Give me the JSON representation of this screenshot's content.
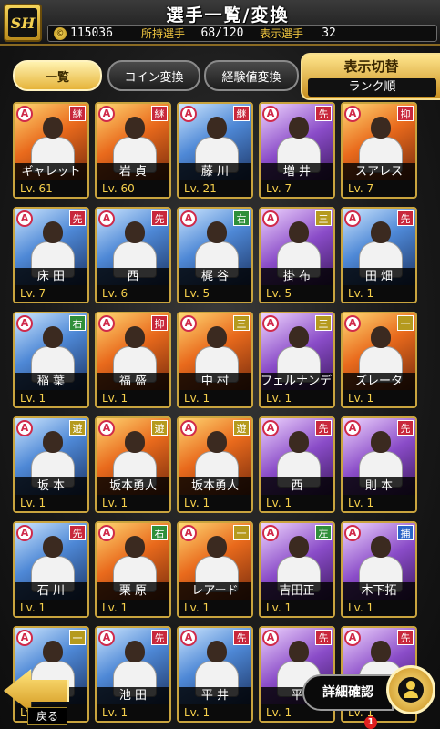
{
  "header": {
    "logo_text": "SH",
    "title": "選手一覧/変換",
    "coin_icon_glyph": "©",
    "coins": "115036",
    "owned_label": "所持選手",
    "owned_value": "68/120",
    "displayed_label": "表示選手",
    "displayed_value": "32"
  },
  "tabs": [
    {
      "label": "一覧",
      "active": true
    },
    {
      "label": "コイン変換",
      "active": false
    },
    {
      "label": "経験値変換",
      "active": false
    }
  ],
  "view_toggle": {
    "label": "表示切替",
    "sort": "ランク順"
  },
  "level_prefix": "Lv.",
  "players": [
    {
      "rank": "A",
      "pos": "継",
      "pos_color": "#c8283c",
      "name": "ギャレット",
      "level": "61",
      "bg": "orange"
    },
    {
      "rank": "A",
      "pos": "継",
      "pos_color": "#c8283c",
      "name": "岩 貞",
      "level": "60",
      "bg": "orange"
    },
    {
      "rank": "A",
      "pos": "継",
      "pos_color": "#c8283c",
      "name": "藤 川",
      "level": "21",
      "bg": "blue"
    },
    {
      "rank": "A",
      "pos": "先",
      "pos_color": "#c8283c",
      "name": "増 井",
      "level": "7",
      "bg": "purple"
    },
    {
      "rank": "A",
      "pos": "抑",
      "pos_color": "#c8283c",
      "name": "スアレス",
      "level": "7",
      "bg": "orange"
    },
    {
      "rank": "A",
      "pos": "先",
      "pos_color": "#c8283c",
      "name": "床 田",
      "level": "7",
      "bg": "blue"
    },
    {
      "rank": "A",
      "pos": "先",
      "pos_color": "#c8283c",
      "name": "西",
      "level": "6",
      "bg": "blue"
    },
    {
      "rank": "A",
      "pos": "右",
      "pos_color": "#2f8f3a",
      "name": "梶 谷",
      "level": "5",
      "bg": "blue"
    },
    {
      "rank": "A",
      "pos": "三",
      "pos_color": "#b59a1e",
      "name": "掛 布",
      "level": "5",
      "bg": "purple"
    },
    {
      "rank": "A",
      "pos": "先",
      "pos_color": "#c8283c",
      "name": "田 畑",
      "level": "1",
      "bg": "blue"
    },
    {
      "rank": "A",
      "pos": "右",
      "pos_color": "#2f8f3a",
      "name": "稲 葉",
      "level": "1",
      "bg": "blue"
    },
    {
      "rank": "A",
      "pos": "抑",
      "pos_color": "#c8283c",
      "name": "福 盛",
      "level": "1",
      "bg": "orange"
    },
    {
      "rank": "A",
      "pos": "三",
      "pos_color": "#b59a1e",
      "name": "中 村",
      "level": "1",
      "bg": "orange"
    },
    {
      "rank": "A",
      "pos": "三",
      "pos_color": "#b59a1e",
      "name": "フェルナンデス",
      "level": "1",
      "bg": "purple"
    },
    {
      "rank": "A",
      "pos": "一",
      "pos_color": "#b59a1e",
      "name": "ズレータ",
      "level": "1",
      "bg": "orange"
    },
    {
      "rank": "A",
      "pos": "遊",
      "pos_color": "#b59a1e",
      "name": "坂 本",
      "level": "1",
      "bg": "blue"
    },
    {
      "rank": "A",
      "pos": "遊",
      "pos_color": "#b59a1e",
      "name": "坂本勇人",
      "level": "1",
      "bg": "orange"
    },
    {
      "rank": "A",
      "pos": "遊",
      "pos_color": "#b59a1e",
      "name": "坂本勇人",
      "level": "1",
      "bg": "orange"
    },
    {
      "rank": "A",
      "pos": "先",
      "pos_color": "#c8283c",
      "name": "西",
      "level": "1",
      "bg": "purple"
    },
    {
      "rank": "A",
      "pos": "先",
      "pos_color": "#c8283c",
      "name": "則 本",
      "level": "1",
      "bg": "purple"
    },
    {
      "rank": "A",
      "pos": "先",
      "pos_color": "#c8283c",
      "name": "石 川",
      "level": "1",
      "bg": "blue"
    },
    {
      "rank": "A",
      "pos": "右",
      "pos_color": "#2f8f3a",
      "name": "栗 原",
      "level": "1",
      "bg": "orange"
    },
    {
      "rank": "A",
      "pos": "一",
      "pos_color": "#b59a1e",
      "name": "レアード",
      "level": "1",
      "bg": "orange"
    },
    {
      "rank": "A",
      "pos": "左",
      "pos_color": "#2f8f3a",
      "name": "吉田正",
      "level": "1",
      "bg": "purple"
    },
    {
      "rank": "A",
      "pos": "捕",
      "pos_color": "#2a64c8",
      "name": "木下拓",
      "level": "1",
      "bg": "purple"
    },
    {
      "rank": "A",
      "pos": "一",
      "pos_color": "#b59a1e",
      "name": "ド",
      "level": "1",
      "bg": "blue"
    },
    {
      "rank": "A",
      "pos": "先",
      "pos_color": "#c8283c",
      "name": "池 田",
      "level": "1",
      "bg": "blue"
    },
    {
      "rank": "A",
      "pos": "先",
      "pos_color": "#c8283c",
      "name": "平 井",
      "level": "1",
      "bg": "blue"
    },
    {
      "rank": "A",
      "pos": "先",
      "pos_color": "#c8283c",
      "name": "平",
      "level": "1",
      "bg": "purple"
    },
    {
      "rank": "A",
      "pos": "先",
      "pos_color": "#c8283c",
      "name": "",
      "level": "1",
      "bg": "purple"
    }
  ],
  "footer": {
    "back_label": "戻る",
    "detail_label": "詳細確認",
    "notification_count": "1"
  }
}
